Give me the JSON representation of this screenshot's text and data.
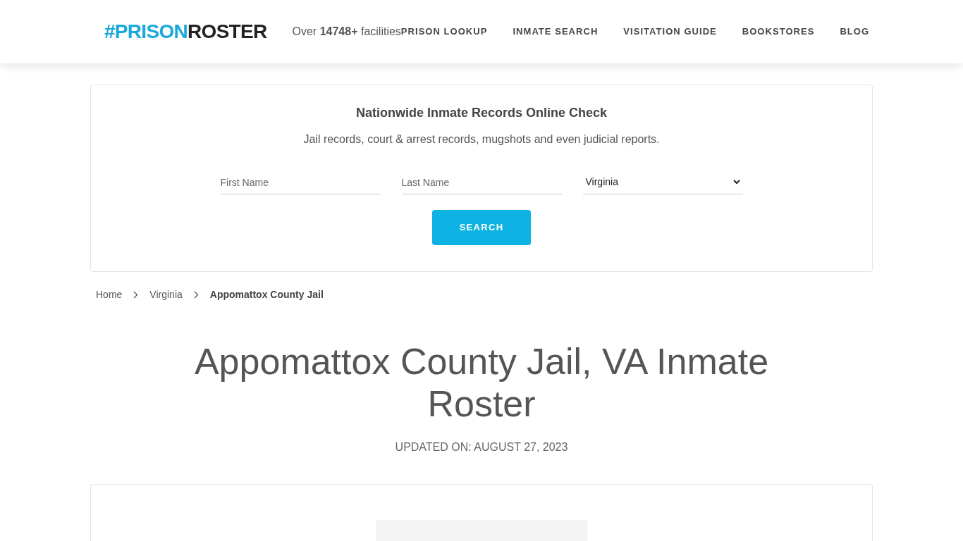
{
  "header": {
    "logo": {
      "accent": "#PRISON",
      "main": "ROSTER"
    },
    "tagline": "Over **14748+** facilities",
    "nav": [
      "PRISON LOOKUP",
      "INMATE SEARCH",
      "VISITATION GUIDE",
      "BOOKSTORES",
      "BLOG"
    ]
  },
  "search_card": {
    "title": "Nationwide Inmate Records Online Check",
    "subtitle": "Jail records, court & arrest records, mugshots and even judicial reports.",
    "first_name": {
      "placeholder": "First Name"
    },
    "last_name": {
      "placeholder": "Last Name"
    },
    "state": {
      "value": "Virginia"
    },
    "button": "SEARCH"
  },
  "breadcrumb": [
    {
      "label": "Home",
      "current": false
    },
    {
      "label": "Virginia",
      "current": false
    },
    {
      "label": "Appomattox County Jail",
      "current": true
    }
  ],
  "page_title": "Appomattox County Jail, VA Inmate Roster",
  "updated": "UPDATED ON: AUGUST 27, 2023"
}
